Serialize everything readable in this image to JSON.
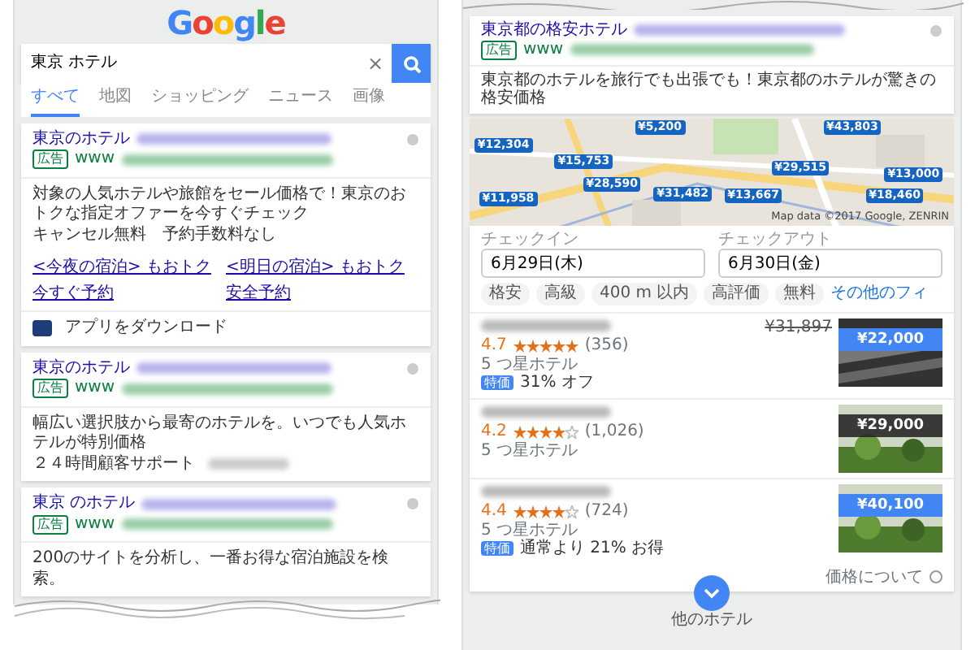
{
  "left_screen": {
    "logo": "Google",
    "search": {
      "value": "東京 ホテル",
      "clear": "×"
    },
    "tabs": [
      {
        "label": "すべて",
        "selected": true
      },
      {
        "label": "地図",
        "selected": false
      },
      {
        "label": "ショッピング",
        "selected": false
      },
      {
        "label": "ニュース",
        "selected": false
      },
      {
        "label": "画像",
        "selected": false
      }
    ],
    "results": [
      {
        "title": "東京のホテル",
        "ad_label": "広告",
        "url": "www",
        "description": "対象の人気ホテルや旅館をセール価格で！東京のおトクな指定オファーを今すぐチェック",
        "extra": "キャンセル無料　予約手数料なし",
        "sitelinks": [
          "<今夜の宿泊> もおトク",
          "<明日の宿泊> もおトク",
          "今すぐ予約",
          "安全予約"
        ],
        "app_link": "アプリをダウンロード"
      },
      {
        "title": "東京のホテル",
        "ad_label": "広告",
        "url": "www",
        "description": "幅広い選択肢から最寄のホテルを。いつでも人気ホテルが特別価格",
        "extra": "２４時間顧客サポート"
      },
      {
        "title": "東京 のホテル",
        "ad_label": "広告",
        "url": "www",
        "description": "200のサイトを分析し、一番お得な宿泊施設を検索。"
      }
    ]
  },
  "right_screen": {
    "result": {
      "title": "東京都の格安ホテル",
      "ad_label": "広告",
      "url": "www",
      "description": "東京都のホテルを旅行でも出張でも！東京都のホテルが驚きの格安価格"
    },
    "map": {
      "pins": [
        "¥5,200",
        "¥12,304",
        "¥15,753",
        "¥28,590",
        "¥31,482",
        "¥11,958",
        "¥43,803",
        "¥29,515",
        "¥13,000",
        "¥13,667",
        "¥18,460"
      ],
      "attribution": "Map data ©2017 Google, ZENRIN"
    },
    "checkin": {
      "label": "チェックイン",
      "value": "6月29日(木)"
    },
    "checkout": {
      "label": "チェックアウト",
      "value": "6月30日(金)"
    },
    "filters": [
      "格安",
      "高級",
      "400 m 以内",
      "高評価",
      "無料",
      "その他のフィ"
    ],
    "hotels": [
      {
        "rating": "4.7",
        "stars": 5,
        "reviews": "(356)",
        "hotel_class": "5 つ星ホテル",
        "deal_label": "特価",
        "deal": "31% オフ",
        "old_price": "¥31,897",
        "price": "¥22,000",
        "highlighted": true
      },
      {
        "rating": "4.2",
        "stars": 4,
        "reviews": "(1,026)",
        "hotel_class": "5 つ星ホテル",
        "price": "¥29,000",
        "highlighted": false
      },
      {
        "rating": "4.4",
        "stars": 4,
        "reviews": "(724)",
        "hotel_class": "5 つ星ホテル",
        "deal_label": "特価",
        "deal": "通常より 21% お得",
        "price": "¥40,100",
        "highlighted": true
      }
    ],
    "price_note": "価格について",
    "more": "他のホテル"
  }
}
